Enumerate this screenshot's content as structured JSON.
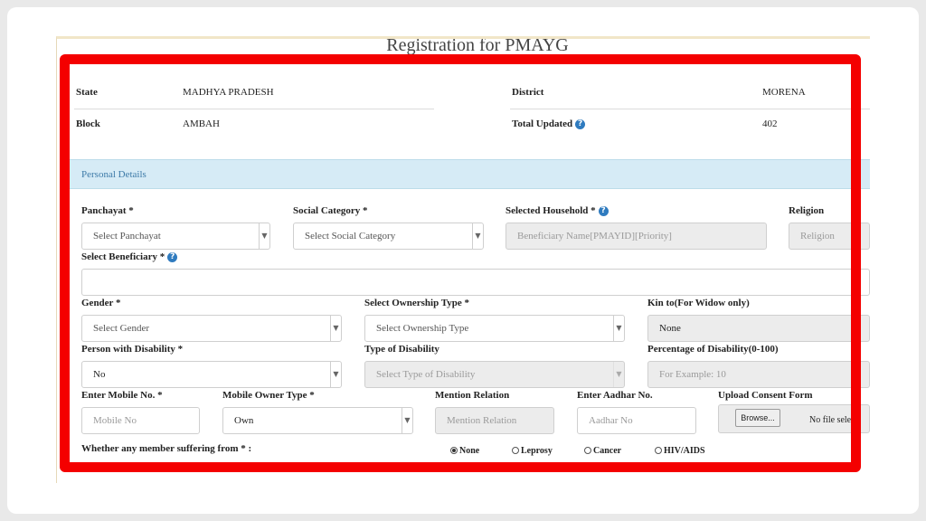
{
  "page_title": "Registration for PMAYG",
  "info": {
    "state_label": "State",
    "state_value": "MADHYA PRADESH",
    "district_label": "District",
    "district_value": "MORENA",
    "block_label": "Block",
    "block_value": "AMBAH",
    "total_updated_label": "Total Updated",
    "total_updated_value": "402"
  },
  "panel": {
    "title": "Personal Details"
  },
  "fields": {
    "panchayat_label": "Panchayat *",
    "panchayat_value": "Select Panchayat",
    "social_category_label": "Social Category *",
    "social_category_value": "Select Social Category",
    "selected_household_label": "Selected Household *",
    "selected_household_placeholder": "Beneficiary Name[PMAYID][Priority]",
    "religion_label": "Religion",
    "religion_placeholder": "Religion",
    "select_beneficiary_label": "Select Beneficiary *",
    "select_beneficiary_value": "",
    "gender_label": "Gender *",
    "gender_value": "Select Gender",
    "ownership_label": "Select Ownership Type *",
    "ownership_value": "Select Ownership Type",
    "kin_label": "Kin to(For Widow only)",
    "kin_value": "None",
    "disability_label": "Person with Disability *",
    "disability_value": "No",
    "disability_type_label": "Type of Disability",
    "disability_type_value": "Select Type of Disability",
    "disability_pct_label": "Percentage of Disability(0-100)",
    "disability_pct_placeholder": "For Example: 10",
    "mobile_label": "Enter Mobile No. *",
    "mobile_placeholder": "Mobile No",
    "mobile_owner_label": "Mobile Owner Type *",
    "mobile_owner_value": "Own",
    "relation_label": "Mention Relation",
    "relation_placeholder": "Mention Relation",
    "aadhar_label": "Enter Aadhar No.",
    "aadhar_placeholder": "Aadhar No",
    "consent_label": "Upload Consent Form",
    "browse_label": "Browse...",
    "file_status": "No file sele"
  },
  "suffering": {
    "label": "Whether any member suffering from * :",
    "options": [
      {
        "label": "None",
        "selected": true
      },
      {
        "label": "Leprosy",
        "selected": false
      },
      {
        "label": "Cancer",
        "selected": false
      },
      {
        "label": "HIV/AIDS",
        "selected": false
      }
    ]
  },
  "icons": {
    "help": "question-circle-icon",
    "dropdown": "caret-down-icon"
  },
  "colors": {
    "highlight_frame": "#f40000",
    "panel_header": "#d6ebf6",
    "help_icon": "#2f7bbf"
  }
}
